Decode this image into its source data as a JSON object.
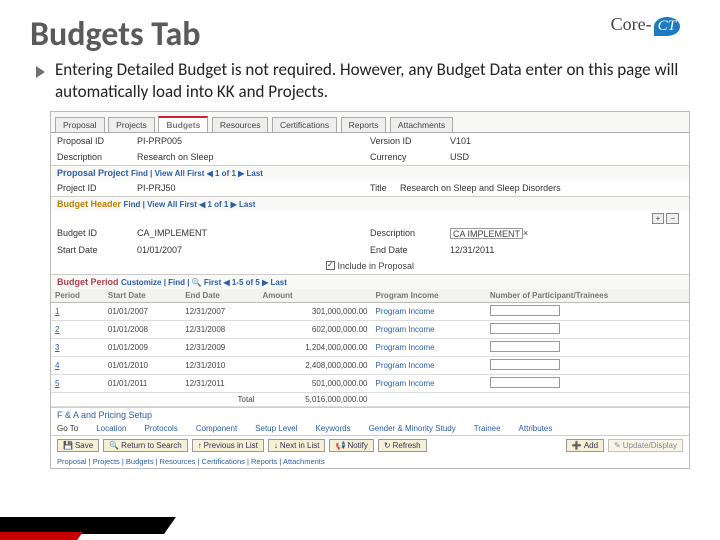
{
  "logo": {
    "brand": "Core-",
    "badge": "CT"
  },
  "title": "Budgets Tab",
  "bullet": "Entering Detailed Budget is not required. However, any Budget Data enter on this page will automatically load into KK and Projects.",
  "tabs": [
    "Proposal",
    "Projects",
    "Budgets",
    "Resources",
    "Certifications",
    "Reports",
    "Attachments"
  ],
  "header": {
    "proposal_id_lbl": "Proposal ID",
    "proposal_id": "PI-PRP005",
    "version_lbl": "Version ID",
    "version": "V101",
    "desc_lbl": "Description",
    "desc": "Research on Sleep",
    "currency_lbl": "Currency",
    "currency": "USD"
  },
  "findbar": "Find | View All    First ◀ 1 of 1 ▶ Last",
  "sect_proposal": "Proposal Project",
  "proj": {
    "id_lbl": "Project ID",
    "id": "PI-PRJ50",
    "title_lbl": "Title",
    "title": "Research on Sleep and Sleep Disorders"
  },
  "sect_budget_header": "Budget Header",
  "bhdr": {
    "budget_id_lbl": "Budget ID",
    "budget_id": "CA_IMPLEMENT",
    "desc_lbl": "Description",
    "desc": "CA IMPLEMENT",
    "start_lbl": "Start Date",
    "start": "01/01/2007",
    "end_lbl": "End Date",
    "end": "12/31/2011",
    "include": "Include in Proposal"
  },
  "sect_budget_period": "Budget Period",
  "customize": "Customize | Find | 🔍    First ◀ 1-5 of 5 ▶ Last",
  "cols": {
    "period": "Period",
    "sdate": "Start Date",
    "edate": "End Date",
    "amount": "Amount",
    "pincome": "Program Income",
    "nparts": "Number of Participant/Trainees"
  },
  "rows": [
    {
      "p": "1",
      "s": "01/01/2007",
      "e": "12/31/2007",
      "a": "301,000,000.00",
      "pi": "Program Income"
    },
    {
      "p": "2",
      "s": "01/01/2008",
      "e": "12/31/2008",
      "a": "602,000,000.00",
      "pi": "Program Income"
    },
    {
      "p": "3",
      "s": "01/01/2009",
      "e": "12/31/2009",
      "a": "1,204,000,000.00",
      "pi": "Program Income"
    },
    {
      "p": "4",
      "s": "01/01/2010",
      "e": "12/31/2010",
      "a": "2,408,000,000.00",
      "pi": "Program Income"
    },
    {
      "p": "5",
      "s": "01/01/2011",
      "e": "12/31/2011",
      "a": "501,000,000.00",
      "pi": "Program Income"
    }
  ],
  "total_lbl": "Total",
  "total": "5,016,000,000.00",
  "fa": "F & A and Pricing Setup",
  "goto_lbl": "Go To",
  "goto": [
    "Location",
    "Protocols",
    "Component",
    "Setup Level",
    "Keywords",
    "Gender & Minority Study",
    "Trainee",
    "Attributes"
  ],
  "btns": {
    "save": "Save",
    "rts": "Return to Search",
    "prev": "Previous in List",
    "next": "Next in List",
    "notify": "Notify",
    "refresh": "Refresh",
    "add": "Add",
    "upd": "Update/Display"
  },
  "bottom": "Proposal | Projects | Budgets | Resources | Certifications | Reports | Attachments"
}
